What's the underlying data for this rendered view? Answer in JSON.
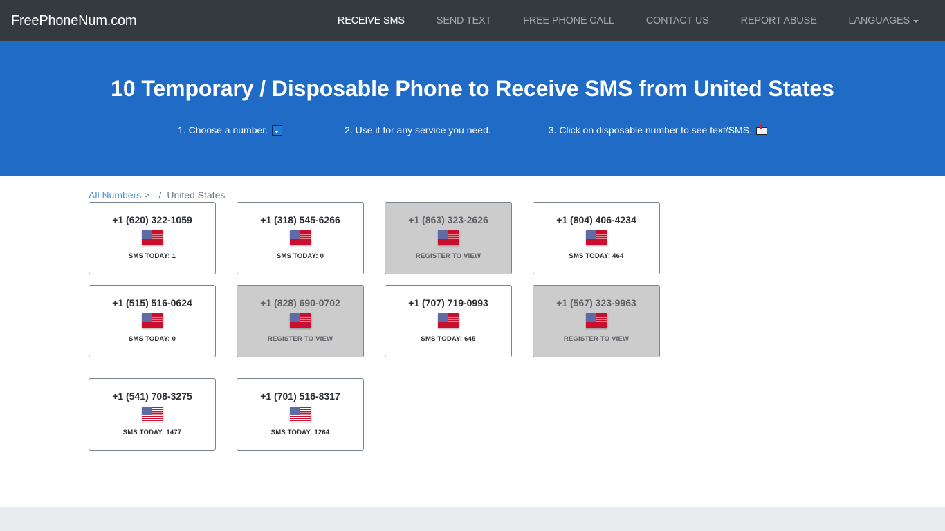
{
  "navbar": {
    "brand": "FreePhoneNum.com",
    "links": [
      {
        "label": "RECEIVE SMS",
        "active": true
      },
      {
        "label": "SEND TEXT",
        "active": false
      },
      {
        "label": "FREE PHONE CALL",
        "active": false
      },
      {
        "label": "CONTACT US",
        "active": false
      },
      {
        "label": "REPORT ABUSE",
        "active": false
      },
      {
        "label": "LANGUAGES",
        "active": false,
        "dropdown": true
      }
    ]
  },
  "hero": {
    "title": "10 Temporary / Disposable Phone to Receive SMS from United States",
    "steps": [
      {
        "text": "1. Choose a number.",
        "icon": "down-arrow-icon"
      },
      {
        "text": "2. Use it for any service you need.",
        "icon": null
      },
      {
        "text": "3. Click on disposable number to see text/SMS.",
        "icon": "envelope-icon"
      }
    ]
  },
  "breadcrumb": {
    "link": "All Numbers",
    "gt": ">",
    "separator": "/",
    "current": "United States"
  },
  "numbers": [
    {
      "number": "+1 (620) 322-1059",
      "status": "SMS TODAY: 1",
      "locked": false,
      "flag": "us-flag"
    },
    {
      "number": "+1 (318) 545-6266",
      "status": "SMS TODAY: 0",
      "locked": false,
      "flag": "us-flag"
    },
    {
      "number": "+1 (863) 323-2626",
      "status": "REGISTER TO VIEW",
      "locked": true,
      "flag": "us-flag"
    },
    {
      "number": "+1 (804) 406-4234",
      "status": "SMS TODAY: 464",
      "locked": false,
      "flag": "us-flag"
    },
    {
      "number": "+1 (515) 516-0624",
      "status": "SMS TODAY: 0",
      "locked": false,
      "flag": "us-flag"
    },
    {
      "number": "+1 (828) 690-0702",
      "status": "REGISTER TO VIEW",
      "locked": true,
      "flag": "us-flag"
    },
    {
      "number": "+1 (707) 719-0993",
      "status": "SMS TODAY: 645",
      "locked": false,
      "flag": "us-flag"
    },
    {
      "number": "+1 (567) 323-9963",
      "status": "REGISTER TO VIEW",
      "locked": true,
      "flag": "us-flag"
    },
    {
      "number": "+1 (541) 708-3275",
      "status": "SMS TODAY: 1477",
      "locked": false,
      "flag": "us-flag"
    },
    {
      "number": "+1 (701) 516-8317",
      "status": "SMS TODAY: 1264",
      "locked": false,
      "flag": "us-flag"
    }
  ],
  "colors": {
    "navbar_bg": "#343a40",
    "hero_bg": "#1f6bc5",
    "locked_card_bg": "#cccccc",
    "link": "#4a8fd8",
    "footer_bg": "#e9ecef"
  }
}
